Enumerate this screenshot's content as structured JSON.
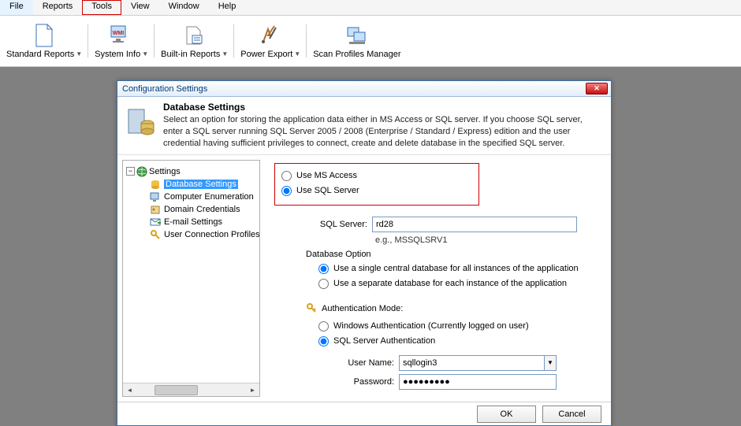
{
  "menu": {
    "items": [
      "File",
      "Reports",
      "Tools",
      "View",
      "Window",
      "Help"
    ],
    "highlighted_index": 2
  },
  "toolbar": {
    "groups": [
      {
        "label": "Standard Reports",
        "has_dropdown": true
      },
      {
        "label": "System Info",
        "has_dropdown": true
      },
      {
        "label": "Built-in Reports",
        "has_dropdown": true
      },
      {
        "label": "Power Export",
        "has_dropdown": true
      },
      {
        "label": "Scan Profiles Manager",
        "has_dropdown": false
      }
    ]
  },
  "dialog": {
    "title": "Configuration Settings",
    "header": {
      "heading": "Database Settings",
      "description": "Select an option for storing the application data either in MS Access or SQL server. If you choose SQL server, enter a SQL server running SQL Server 2005 / 2008 (Enterprise / Standard / Express) edition and the user credential having sufficient privileges to connect, create and delete database in the specified SQL server."
    },
    "tree": {
      "root": "Settings",
      "items": [
        "Database Settings",
        "Computer Enumeration",
        "Domain Credentials",
        "E-mail Settings",
        "User Connection Profiles"
      ],
      "selected_index": 0
    },
    "settings": {
      "storage_options": {
        "msaccess": "Use MS Access",
        "sqlserver": "Use SQL Server",
        "selected": "sqlserver"
      },
      "sql_server_label": "SQL Server:",
      "sql_server_value": "rd28",
      "sql_server_hint": "e.g., MSSQLSRV1",
      "db_option_heading": "Database Option",
      "db_option_single": "Use a single central database for all instances of the application",
      "db_option_separate": "Use a separate database for each instance of the application",
      "db_option_selected": "single",
      "auth_mode_heading": "Authentication Mode:",
      "auth_windows": "Windows Authentication (Currently logged on user)",
      "auth_sql": "SQL Server Authentication",
      "auth_selected": "sql",
      "username_label": "User Name:",
      "username_value": "sqllogin3",
      "password_label": "Password:",
      "password_value": "●●●●●●●●●"
    },
    "buttons": {
      "ok": "OK",
      "cancel": "Cancel"
    }
  }
}
